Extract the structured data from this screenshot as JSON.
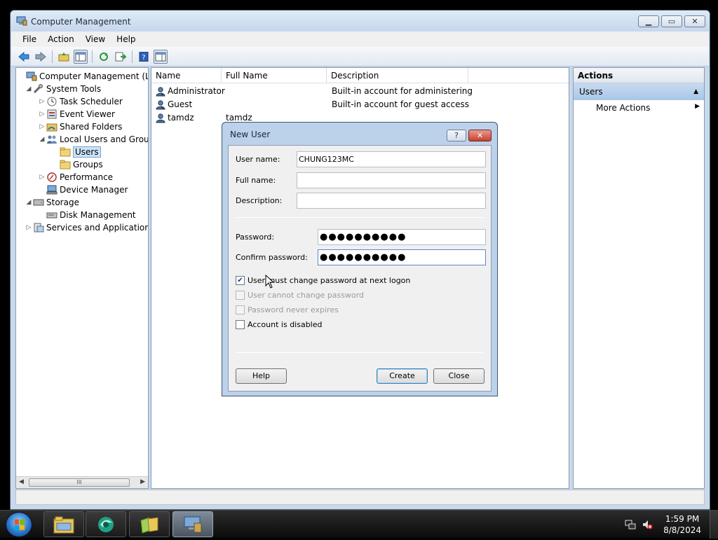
{
  "window": {
    "title": "Computer Management",
    "icon": "computer-management-icon"
  },
  "menu": [
    "File",
    "Action",
    "View",
    "Help"
  ],
  "toolbar": {
    "icons": [
      "back-arrow-icon",
      "forward-arrow-icon",
      "up-folder-icon",
      "show-hide-tree-icon",
      "refresh-icon",
      "export-list-icon",
      "help-icon",
      "show-hide-action-pane-icon"
    ]
  },
  "tree": {
    "items": [
      {
        "label": "Computer Management (Local",
        "icon": "computer-management-icon",
        "expander": "",
        "level": 0
      },
      {
        "label": "System Tools",
        "icon": "tools-icon",
        "expander": "◢",
        "level": 1
      },
      {
        "label": "Task Scheduler",
        "icon": "clock-icon",
        "expander": "▷",
        "level": 2
      },
      {
        "label": "Event Viewer",
        "icon": "event-viewer-icon",
        "expander": "▷",
        "level": 2
      },
      {
        "label": "Shared Folders",
        "icon": "shared-folders-icon",
        "expander": "▷",
        "level": 2
      },
      {
        "label": "Local Users and Groups",
        "icon": "users-group-icon",
        "expander": "◢",
        "level": 2
      },
      {
        "label": "Users",
        "icon": "folder-icon",
        "expander": "",
        "level": 3,
        "selected": true
      },
      {
        "label": "Groups",
        "icon": "folder-icon",
        "expander": "",
        "level": 3
      },
      {
        "label": "Performance",
        "icon": "performance-icon",
        "expander": "▷",
        "level": 2
      },
      {
        "label": "Device Manager",
        "icon": "device-manager-icon",
        "expander": "",
        "level": 2
      },
      {
        "label": "Storage",
        "icon": "storage-icon",
        "expander": "◢",
        "level": 1
      },
      {
        "label": "Disk Management",
        "icon": "disk-icon",
        "expander": "",
        "level": 2
      },
      {
        "label": "Services and Applications",
        "icon": "services-icon",
        "expander": "▷",
        "level": 1
      }
    ],
    "scroll_thumb_text": "III"
  },
  "list": {
    "columns": [
      "Name",
      "Full Name",
      "Description"
    ],
    "rows": [
      {
        "name": "Administrator",
        "full_name": "",
        "description": "Built-in account for administering..."
      },
      {
        "name": "Guest",
        "full_name": "",
        "description": "Built-in account for guest access t..."
      },
      {
        "name": "tamdz",
        "full_name": "tamdz",
        "description": ""
      }
    ]
  },
  "actions": {
    "title": "Actions",
    "section": "Users",
    "items": [
      "More Actions"
    ]
  },
  "dialog": {
    "title": "New User",
    "help_glyph": "?",
    "close_glyph": "✕",
    "username_label": "User name:",
    "username_value": "CHUNG123MC",
    "fullname_label": "Full name:",
    "fullname_value": "",
    "description_label": "Description:",
    "description_value": "",
    "password_label": "Password:",
    "password_value": "●●●●●●●●●●",
    "confirm_label": "Confirm password:",
    "confirm_value": "●●●●●●●●●●",
    "checkboxes": [
      {
        "label": "User must change password at next logon",
        "checked": true,
        "disabled": false
      },
      {
        "label": "User cannot change password",
        "checked": false,
        "disabled": true
      },
      {
        "label": "Password never expires",
        "checked": false,
        "disabled": true
      },
      {
        "label": "Account is disabled",
        "checked": false,
        "disabled": false
      }
    ],
    "help_button": "Help",
    "create_button": "Create",
    "close_button": "Close"
  },
  "taskbar": {
    "apps": [
      "windows-explorer-icon",
      "browser-icon",
      "desktop-folders-icon",
      "computer-management-icon"
    ],
    "time": "1:59 PM",
    "date": "8/8/2024",
    "tray": [
      "network-icon",
      "volume-muted-icon"
    ]
  }
}
